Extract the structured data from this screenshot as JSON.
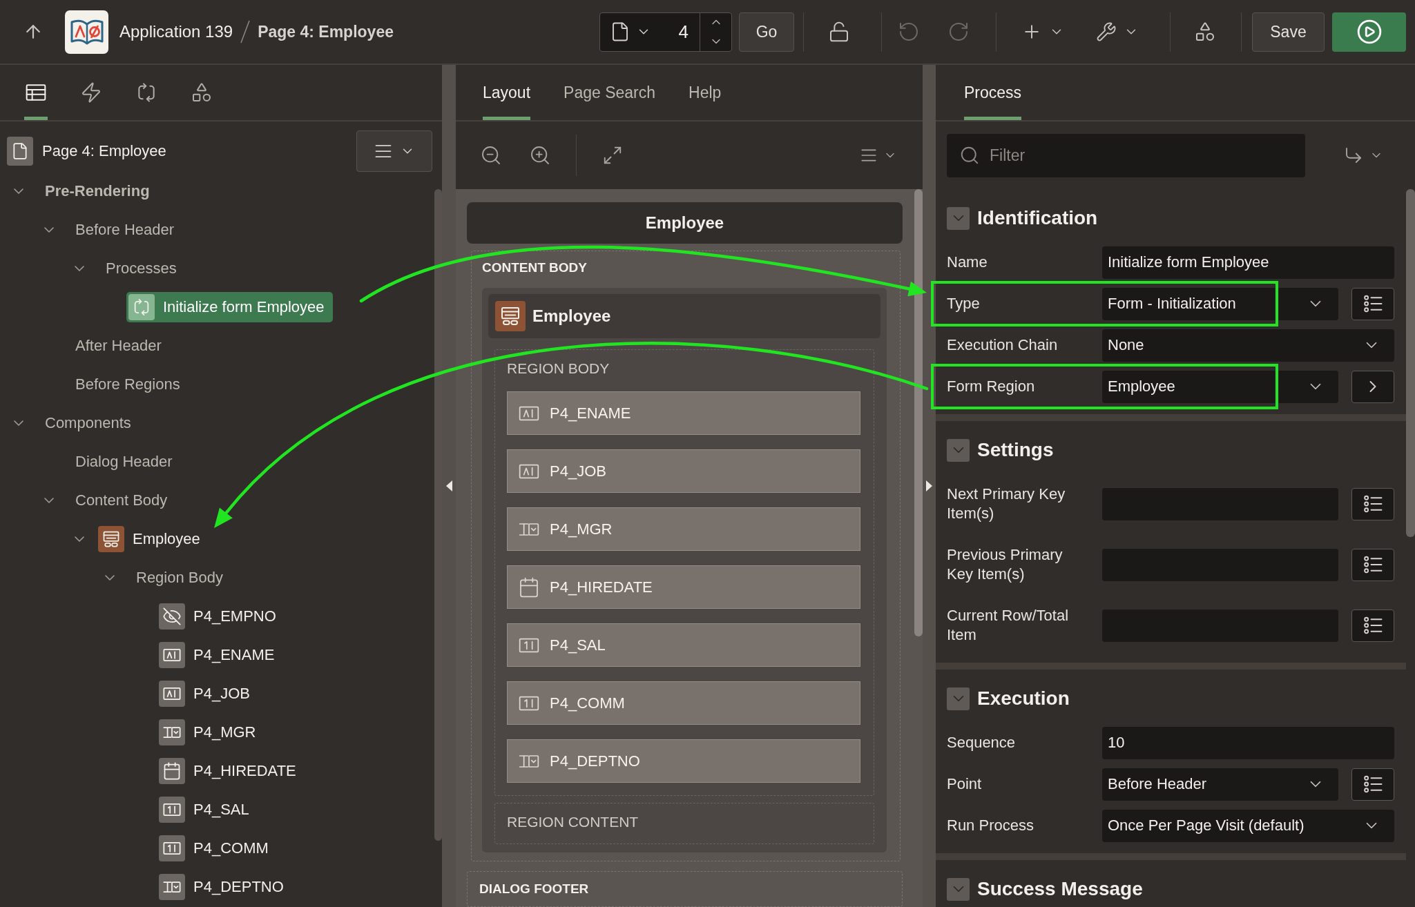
{
  "header": {
    "app_title": "Application 139",
    "page_title": "Page 4: Employee",
    "page_number": "4",
    "go_label": "Go",
    "undo_disabled": true,
    "redo_disabled": true,
    "save_label": "Save"
  },
  "tree_panel": {
    "tabs": [
      {
        "kind": "rendering",
        "selected": true
      },
      {
        "kind": "dynamic-actions",
        "selected": false
      },
      {
        "kind": "processing",
        "selected": false
      },
      {
        "kind": "shared-components",
        "selected": false
      }
    ],
    "page_label": "Page 4: Employee",
    "tree": [
      {
        "label": "Pre-Rendering",
        "kind": "heading",
        "selected": false,
        "expanded": true,
        "children": [
          {
            "label": "Before Header",
            "kind": "group",
            "selected": false,
            "expanded": true,
            "children": [
              {
                "label": "Processes",
                "kind": "group",
                "selected": false,
                "expanded": true,
                "children": [
                  {
                    "label": "Initialize form Employee",
                    "kind": "process",
                    "selected": true
                  }
                ]
              }
            ]
          },
          {
            "label": "After Header",
            "kind": "group",
            "selected": false
          },
          {
            "label": "Before Regions",
            "kind": "group",
            "selected": false
          }
        ]
      },
      {
        "label": "Components",
        "kind": "group",
        "selected": false,
        "expanded": true,
        "children": [
          {
            "label": "Dialog Header",
            "kind": "group",
            "selected": false
          },
          {
            "label": "Content Body",
            "kind": "group",
            "selected": false,
            "expanded": true,
            "children": [
              {
                "label": "Employee",
                "kind": "region",
                "selected": false,
                "expanded": true,
                "children": [
                  {
                    "label": "Region Body",
                    "kind": "group",
                    "selected": false,
                    "expanded": true,
                    "children": [
                      {
                        "label": "P4_EMPNO",
                        "kind": "hidden",
                        "selected": false
                      },
                      {
                        "label": "P4_ENAME",
                        "kind": "text",
                        "selected": false
                      },
                      {
                        "label": "P4_JOB",
                        "kind": "text",
                        "selected": false
                      },
                      {
                        "label": "P4_MGR",
                        "kind": "select",
                        "selected": false
                      },
                      {
                        "label": "P4_HIREDATE",
                        "kind": "date",
                        "selected": false
                      },
                      {
                        "label": "P4_SAL",
                        "kind": "number",
                        "selected": false
                      },
                      {
                        "label": "P4_COMM",
                        "kind": "number",
                        "selected": false
                      },
                      {
                        "label": "P4_DEPTNO",
                        "kind": "select",
                        "selected": false
                      }
                    ]
                  }
                ]
              }
            ]
          }
        ]
      }
    ]
  },
  "layout_panel": {
    "tabs": [
      {
        "label": "Layout",
        "selected": true
      },
      {
        "label": "Page Search",
        "selected": false
      },
      {
        "label": "Help",
        "selected": false
      }
    ],
    "dialog_title": "Employee",
    "content_body_label": "CONTENT BODY",
    "region": {
      "title": "Employee",
      "body_label": "REGION BODY",
      "items": [
        {
          "name": "P4_ENAME",
          "kind": "text"
        },
        {
          "name": "P4_JOB",
          "kind": "text"
        },
        {
          "name": "P4_MGR",
          "kind": "select"
        },
        {
          "name": "P4_HIREDATE",
          "kind": "date"
        },
        {
          "name": "P4_SAL",
          "kind": "number"
        },
        {
          "name": "P4_COMM",
          "kind": "number"
        },
        {
          "name": "P4_DEPTNO",
          "kind": "select"
        }
      ],
      "content_label": "REGION CONTENT"
    },
    "footer_label": "DIALOG FOOTER"
  },
  "property_panel": {
    "tabs": [
      {
        "label": "Process",
        "selected": true
      }
    ],
    "filter": {
      "placeholder": "Filter"
    },
    "sections": [
      {
        "title": "Identification",
        "expanded": true,
        "rows": [
          {
            "label": "Name",
            "kind": "text",
            "value": "Initialize form Employee",
            "highlighted": false
          },
          {
            "label": "Type",
            "kind": "select",
            "value": "Form - Initialization",
            "side_button": {
              "kind": "list"
            },
            "highlighted": true
          },
          {
            "label": "Execution Chain",
            "kind": "select",
            "value": "None",
            "highlighted": false
          },
          {
            "label": "Form Region",
            "kind": "select",
            "value": "Employee",
            "side_button": {
              "kind": "go-to"
            },
            "highlighted": true
          }
        ]
      },
      {
        "title": "Settings",
        "expanded": true,
        "rows": [
          {
            "label": "Next Primary Key Item(s)",
            "kind": "text",
            "side_button": {
              "kind": "list"
            },
            "highlighted": false
          },
          {
            "label": "Previous Primary Key Item(s)",
            "kind": "text",
            "side_button": {
              "kind": "list"
            },
            "highlighted": false
          },
          {
            "label": "Current Row/Total Item",
            "kind": "text",
            "side_button": {
              "kind": "list"
            },
            "highlighted": false
          }
        ]
      },
      {
        "title": "Execution",
        "expanded": true,
        "rows": [
          {
            "label": "Sequence",
            "kind": "text",
            "value": "10",
            "highlighted": false
          },
          {
            "label": "Point",
            "kind": "select",
            "value": "Before Header",
            "side_button": {
              "kind": "list"
            },
            "highlighted": false
          },
          {
            "label": "Run Process",
            "kind": "select",
            "value": "Once Per Page Visit (default)",
            "highlighted": false
          }
        ]
      },
      {
        "title": "Success Message",
        "expanded": true
      }
    ]
  }
}
